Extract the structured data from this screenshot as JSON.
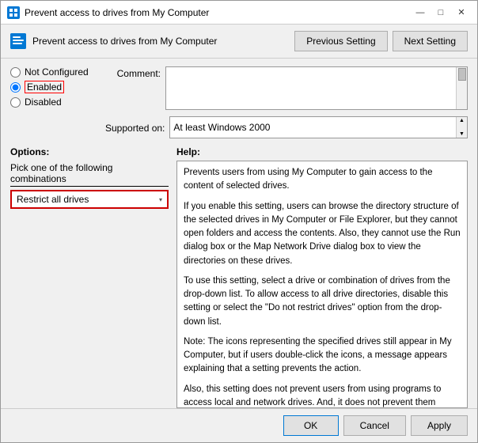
{
  "titleBar": {
    "title": "Prevent access to drives from My Computer",
    "icon": "computer-policy-icon",
    "minimizeLabel": "—",
    "maximizeLabel": "□",
    "closeLabel": "✕"
  },
  "header": {
    "icon": "policy-icon",
    "title": "Prevent access to drives from My Computer",
    "prevButton": "Previous Setting",
    "nextButton": "Next Setting"
  },
  "radioGroup": {
    "notConfigured": "Not Configured",
    "enabled": "Enabled",
    "disabled": "Disabled",
    "selectedValue": "enabled"
  },
  "commentLabel": "Comment:",
  "supportedLabel": "Supported on:",
  "supportedValue": "At least Windows 2000",
  "optionsPanel": {
    "title": "Options:",
    "comboLabel": "Pick one of the following combinations",
    "comboValue": "Restrict all drives"
  },
  "helpPanel": {
    "title": "Help:",
    "paragraphs": [
      "Prevents users from using My Computer to gain access to the content of selected drives.",
      "If you enable this setting, users can browse the directory structure of the selected drives in My Computer or File Explorer, but they cannot open folders and access the contents. Also, they cannot use the Run dialog box or the Map Network Drive dialog box to view the directories on these drives.",
      "To use this setting, select a drive or combination of drives from the drop-down list. To allow access to all drive directories, disable this setting or select the \"Do not restrict drives\" option from the drop-down list.",
      "Note: The icons representing the specified drives still appear in My Computer, but if users double-click the icons, a message appears explaining that a setting prevents the action.",
      "Also, this setting does not prevent users from using programs to access local and network drives. And, it does not prevent them"
    ]
  },
  "footer": {
    "okLabel": "OK",
    "cancelLabel": "Cancel",
    "applyLabel": "Apply"
  }
}
